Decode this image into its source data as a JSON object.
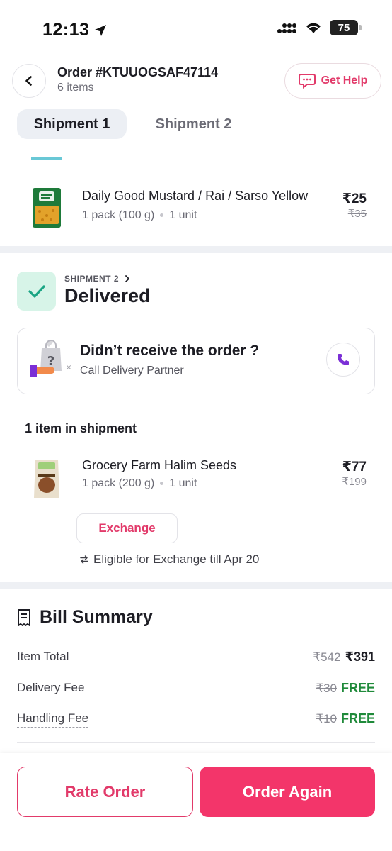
{
  "status_bar": {
    "time": "12:13",
    "battery": "75"
  },
  "header": {
    "order_title": "Order #KTUUOGSAF47114",
    "item_count": "6 items",
    "help_label": "Get Help"
  },
  "tabs": [
    {
      "label": "Shipment 1",
      "active": true
    },
    {
      "label": "Shipment 2",
      "active": false
    }
  ],
  "shipment1_item": {
    "name": "Daily Good Mustard / Rai / Sarso Yellow",
    "pack": "1 pack (100 g)",
    "units": "1 unit",
    "price": "₹25",
    "mrp": "₹35"
  },
  "shipment2": {
    "label": "SHIPMENT 2",
    "status": "Delivered",
    "card_title": "Didn’t receive the order ?",
    "card_sub": "Call Delivery Partner",
    "items_heading": "1 item in shipment",
    "item": {
      "name": "Grocery Farm Halim Seeds",
      "pack": "1 pack (200 g)",
      "units": "1 unit",
      "price": "₹77",
      "mrp": "₹199"
    },
    "exchange_label": "Exchange",
    "eligible_text": "Eligible for Exchange till Apr 20"
  },
  "bill": {
    "title": "Bill Summary",
    "rows": [
      {
        "label": "Item Total",
        "strike": "₹542",
        "value": "₹391"
      },
      {
        "label": "Delivery Fee",
        "strike": "₹30",
        "value": "FREE"
      },
      {
        "label": "Handling Fee",
        "strike": "₹10",
        "value": "FREE"
      }
    ]
  },
  "footer": {
    "rate_label": "Rate Order",
    "again_label": "Order Again"
  },
  "colors": {
    "accent": "#e23a6a",
    "primary_button": "#f3356a",
    "free_green": "#1f8a3a",
    "check_bg": "#d7f4e8",
    "check_green": "#1aa584"
  }
}
